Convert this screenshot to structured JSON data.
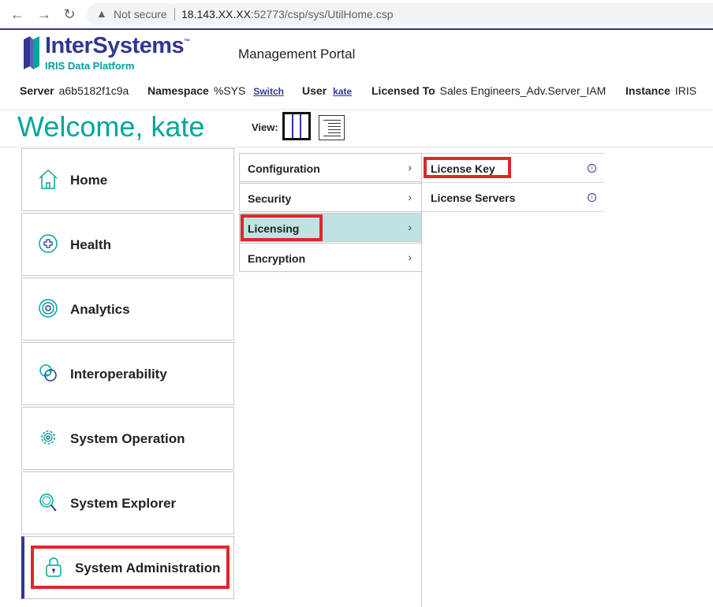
{
  "browser": {
    "security_label": "Not secure",
    "url_host": "18.143.",
    "url_host_masked": "XX.XX",
    "url_rest": ":52773/csp/sys/UtilHome.csp"
  },
  "brand": {
    "name": "InterSystems",
    "trademark": "™",
    "product": "IRIS Data Platform",
    "portal_title": "Management Portal"
  },
  "server_info": {
    "server_label": "Server",
    "server_value": "a6b5182f1c9a",
    "namespace_label": "Namespace",
    "namespace_value": "%SYS",
    "switch_label": "Switch",
    "user_label": "User",
    "user_value": "kate",
    "licensed_label": "Licensed To",
    "licensed_value": "Sales Engineers_Adv.Server_IAM",
    "instance_label": "Instance",
    "instance_value": "IRIS"
  },
  "welcome": "Welcome, kate",
  "view_label": "View:",
  "main_menu": [
    {
      "label": "Home",
      "icon": "home-icon"
    },
    {
      "label": "Health",
      "icon": "health-icon"
    },
    {
      "label": "Analytics",
      "icon": "analytics-icon"
    },
    {
      "label": "Interoperability",
      "icon": "interoperability-icon"
    },
    {
      "label": "System Operation",
      "icon": "gear-icon"
    },
    {
      "label": "System Explorer",
      "icon": "magnifier-icon"
    },
    {
      "label": "System Administration",
      "icon": "lock-icon",
      "active": true
    }
  ],
  "sub_menu": [
    {
      "label": "Configuration"
    },
    {
      "label": "Security"
    },
    {
      "label": "Licensing",
      "selected": true
    },
    {
      "label": "Encryption"
    }
  ],
  "options_menu": [
    {
      "label": "License Key"
    },
    {
      "label": "License Servers"
    }
  ],
  "colors": {
    "brand_purple": "#333695",
    "brand_teal": "#00a59c",
    "highlight_red": "#e0262b",
    "selected_bg": "#bfe3e3"
  }
}
